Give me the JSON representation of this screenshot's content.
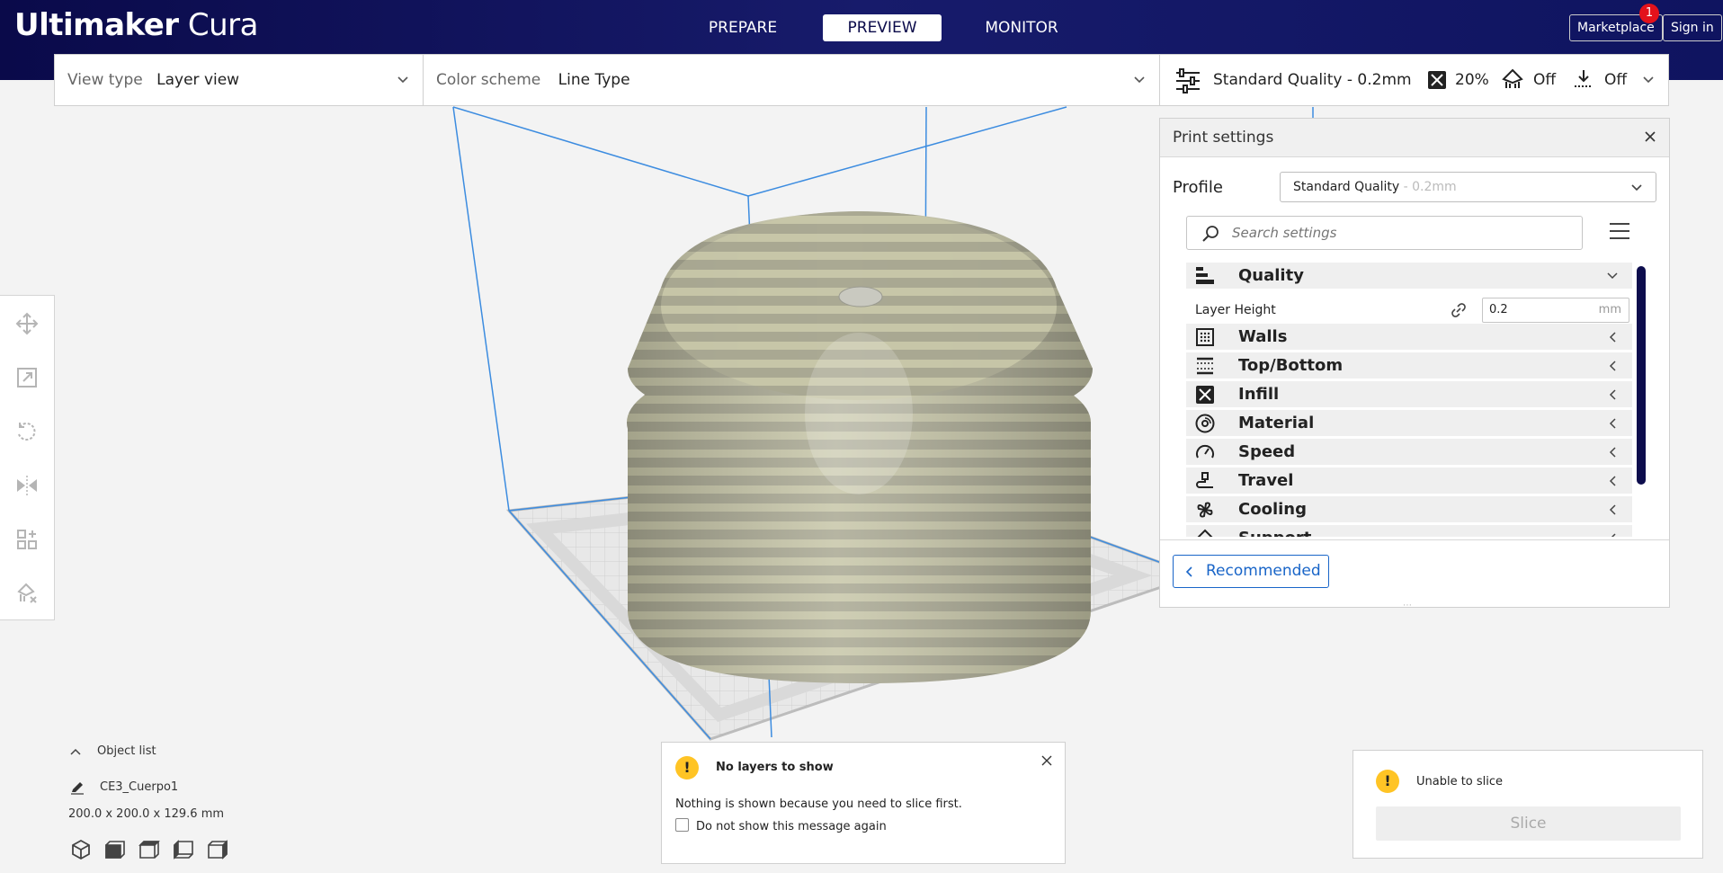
{
  "app": {
    "brand_bold": "Ultimaker",
    "brand_light": "Cura"
  },
  "stages": [
    {
      "label": "PREPARE",
      "active": false
    },
    {
      "label": "PREVIEW",
      "active": true
    },
    {
      "label": "MONITOR",
      "active": false
    }
  ],
  "header_buttons": {
    "marketplace": "Marketplace",
    "marketplace_badge": "1",
    "signin": "Sign in"
  },
  "viewbar": {
    "view_type_label": "View type",
    "view_type_value": "Layer view",
    "color_scheme_label": "Color scheme",
    "color_scheme_value": "Line Type"
  },
  "settings_bar": {
    "profile": "Standard Quality - 0.2mm",
    "infill": "20%",
    "support": "Off",
    "adhesion": "Off"
  },
  "print_settings": {
    "title": "Print settings",
    "profile_label": "Profile",
    "profile_name": "Standard Quality",
    "profile_suffix": " - 0.2mm",
    "search_placeholder": "Search settings",
    "categories": [
      {
        "label": "Quality",
        "icon": "quality-icon",
        "expanded": true
      },
      {
        "label": "Walls",
        "icon": "walls-icon"
      },
      {
        "label": "Top/Bottom",
        "icon": "top-bottom-icon"
      },
      {
        "label": "Infill",
        "icon": "infill-icon"
      },
      {
        "label": "Material",
        "icon": "material-icon"
      },
      {
        "label": "Speed",
        "icon": "speed-icon"
      },
      {
        "label": "Travel",
        "icon": "travel-icon"
      },
      {
        "label": "Cooling",
        "icon": "cooling-icon"
      },
      {
        "label": "Support",
        "icon": "support-icon"
      }
    ],
    "layer_height": {
      "label": "Layer Height",
      "value": "0.2",
      "unit": "mm"
    },
    "recommended_label": "Recommended"
  },
  "object_list": {
    "title": "Object list",
    "object_name": "CE3_Cuerpo1",
    "dimensions": "200.0 x 200.0 x 129.6 mm"
  },
  "messages": {
    "no_layers": {
      "title": "No layers to show",
      "body": "Nothing is shown because you need to slice first.",
      "checkbox_label": "Do not show this message again"
    },
    "unable": {
      "title": "Unable to slice",
      "button": "Slice"
    }
  },
  "colors": {
    "header_dark": "#0a0a4a",
    "accent_blue": "#1965c8",
    "warning": "#ffc425",
    "badge_red": "#e3121b"
  }
}
